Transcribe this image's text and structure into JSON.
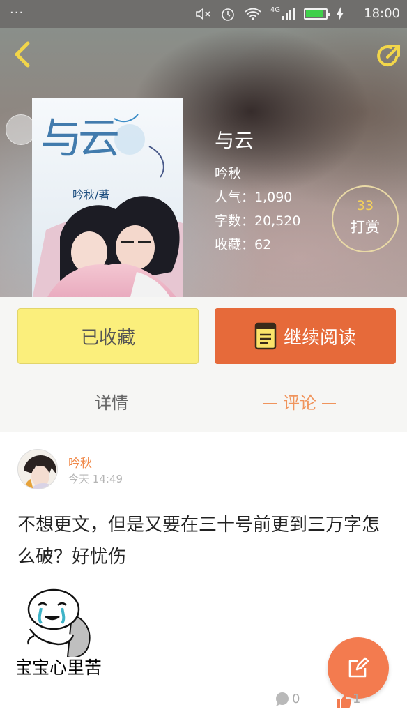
{
  "status_bar": {
    "dots": "···",
    "time": "18:00",
    "network": "4G",
    "battery_level": 0.85,
    "battery_color": "#3fd04a"
  },
  "header": {
    "back_icon": "chevron-left-icon",
    "share_icon": "share-icon",
    "accent": "#f2d64a"
  },
  "book": {
    "title": "与云",
    "author": "吟秋",
    "popularity_label": "人气：1,090",
    "word_count_label": "字数：20,520",
    "favorites_label": "收藏：62",
    "cover_title": "与云",
    "cover_author": "吟秋/著"
  },
  "tip": {
    "count": "33",
    "label": "打赏"
  },
  "actions": {
    "favorite_label": "已收藏",
    "read_label": "继续阅读",
    "favorite_color": "#fbef7c",
    "read_color": "#e66a3a"
  },
  "tabs": {
    "detail": "详情",
    "comment": "评论"
  },
  "comment": {
    "author": "吟秋",
    "time": "今天 14:49",
    "text": "不想更文，但是又要在三十号前更到三万字怎么破？好忧伤",
    "sticker_caption": "宝宝心里苦",
    "reply_count": "0",
    "like_count": "1"
  },
  "fab": {
    "icon": "edit-icon",
    "color": "#f37b4f"
  }
}
